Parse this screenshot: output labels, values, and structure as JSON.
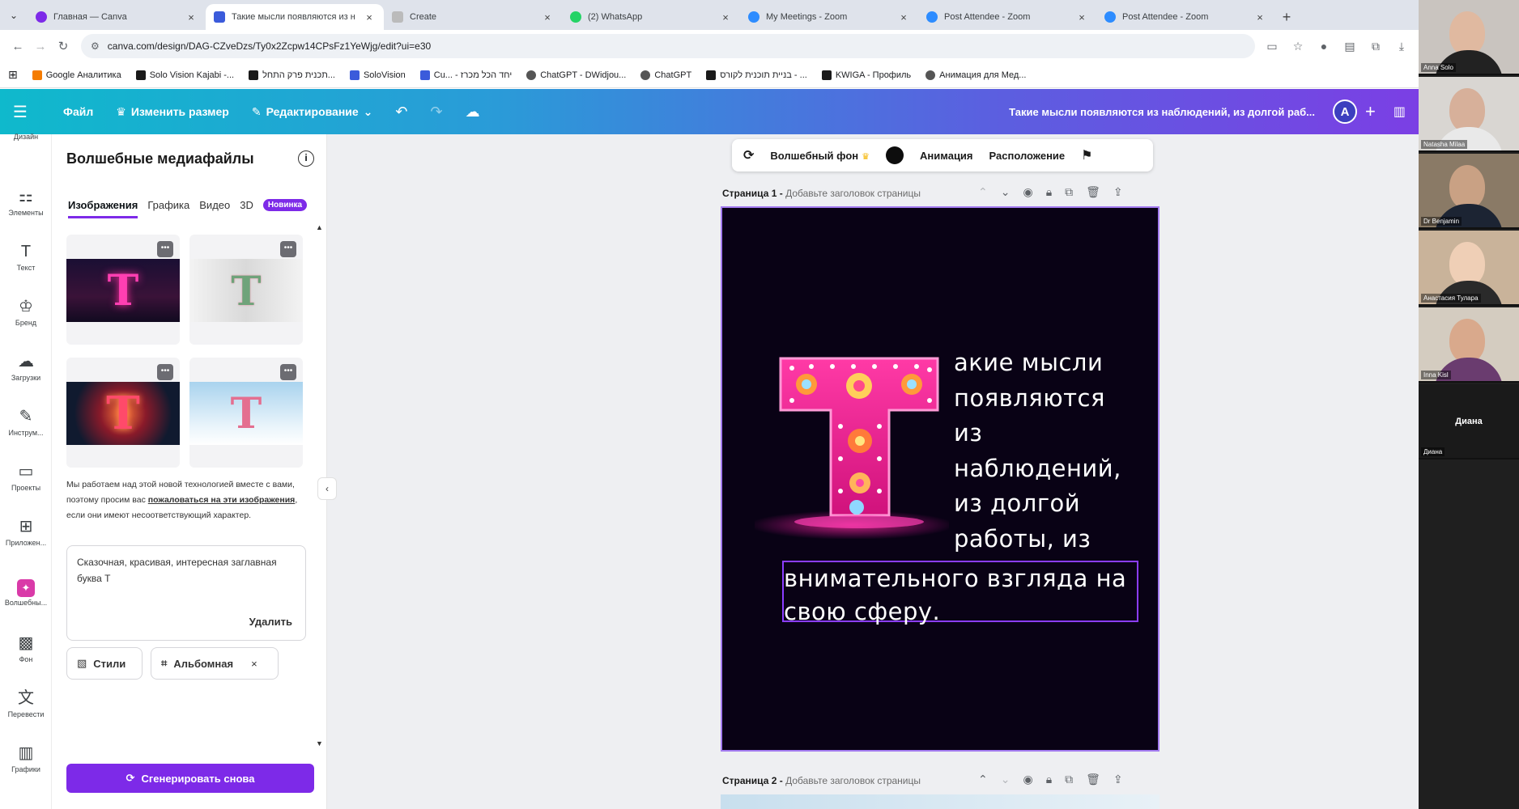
{
  "browser": {
    "tabs": [
      {
        "title": "Главная — Canva",
        "color": "#7d2ae8",
        "active": false
      },
      {
        "title": "Такие мысли появляются из н",
        "color": "#3b5bdb",
        "active": true
      },
      {
        "title": "Create",
        "color": "#999999",
        "active": false
      },
      {
        "title": "(2) WhatsApp",
        "color": "#25d366",
        "active": false
      },
      {
        "title": "My Meetings - Zoom",
        "color": "#2d8cff",
        "active": false
      },
      {
        "title": "Post Attendee - Zoom",
        "color": "#2d8cff",
        "active": false
      },
      {
        "title": "Post Attendee - Zoom",
        "color": "#2d8cff",
        "active": false
      }
    ],
    "url": "canva.com/design/DAG-CZveDzs/Ty0x2Zcpw14CPsFz1YeWjg/edit?ui=e30",
    "bookmarks": [
      {
        "label": "Google Аналитика",
        "color": "#f57c00"
      },
      {
        "label": "Solo Vision Kajabi -...",
        "color": "#1a1a1a"
      },
      {
        "label": "תכנית פרק התחל...",
        "color": "#1a1a1a"
      },
      {
        "label": "SoloVision",
        "color": "#3b5bdb"
      },
      {
        "label": "Cu... - יחד הכל מכרז",
        "color": "#3b5bdb"
      },
      {
        "label": "ChatGPT - DWidjou...",
        "color": "#555555"
      },
      {
        "label": "ChatGPT",
        "color": "#555555"
      },
      {
        "label": "בניית תוכנית לקורס - ...",
        "color": "#1a1a1a"
      },
      {
        "label": "KWIGA - Профиль",
        "color": "#1a1a1a"
      },
      {
        "label": "Анимация для Мед...",
        "color": "#555555"
      }
    ]
  },
  "header": {
    "menu_file": "Файл",
    "menu_resize": "Изменить размер",
    "menu_edit": "Редактирование",
    "doc_title": "Такие мысли появляются из наблюдений, из долгой раб...",
    "avatar_letter": "A"
  },
  "rail": [
    {
      "label": "Дизайн",
      "icon": "▦"
    },
    {
      "label": "Элементы",
      "icon": "⚏"
    },
    {
      "label": "Текст",
      "icon": "T"
    },
    {
      "label": "Бренд",
      "icon": "♔"
    },
    {
      "label": "Загрузки",
      "icon": "☁"
    },
    {
      "label": "Инструм...",
      "icon": "✎"
    },
    {
      "label": "Проекты",
      "icon": "▭"
    },
    {
      "label": "Приложен...",
      "icon": "⊞"
    },
    {
      "label": "Волшебны...",
      "icon": "✦"
    },
    {
      "label": "Фон",
      "icon": "▩"
    },
    {
      "label": "Перевести",
      "icon": "文"
    },
    {
      "label": "Графики",
      "icon": "▥"
    }
  ],
  "panel": {
    "title": "Волшебные медиафайлы",
    "tabs": [
      "Изображения",
      "Графика",
      "Видео",
      "3D"
    ],
    "new_badge": "Новинка",
    "disclaimer_before": "Мы работаем над этой новой технологией вместе с вами, поэтому просим вас ",
    "disclaimer_link": "пожаловаться на эти изображения",
    "disclaimer_after": ", если они имеют несоответствующий характер.",
    "prompt": "Сказочная, красивая, интересная заглавная буква Т",
    "delete": "Удалить",
    "chip_styles": "Стили",
    "chip_format": "Альбомная",
    "regenerate": "Сгенерировать снова"
  },
  "toolbar": {
    "magic_bg": "Волшебный фон",
    "animation": "Анимация",
    "position": "Расположение"
  },
  "pages": {
    "page1_label": "Страница 1 -",
    "page1_hint": "Добавьте заголовок страницы",
    "page2_label": "Страница 2 -",
    "page2_hint": "Добавьте заголовок страницы"
  },
  "design": {
    "big_letter": "T",
    "lines": [
      "акие мысли",
      "появляются",
      "из",
      "наблюдений,",
      "из долгой",
      "работы, из"
    ],
    "selected_text_1": "внимательного взгляда на",
    "selected_text_2": "свою сферу."
  },
  "zoom": [
    {
      "name": "Anna Solo",
      "bg": "#c9c4bf",
      "skin": "#e0b9a0",
      "shirt": "#222222"
    },
    {
      "name": "Natasha Milaa",
      "bg": "#d9d6d2",
      "skin": "#d7b09a",
      "shirt": "#e9e9e9"
    },
    {
      "name": "Dr Benjamin",
      "bg": "#8a7a66",
      "skin": "#c9a184",
      "shirt": "#1c2433"
    },
    {
      "name": "Анастасия Тулара",
      "bg": "#c9b39a",
      "skin": "#efcfb6",
      "shirt": "#2a2a2a"
    },
    {
      "name": "Inna Kisl",
      "bg": "#d4ccc0",
      "skin": "#d9a98c",
      "shirt": "#6a3c6f"
    },
    {
      "name": "Диана",
      "bg": "#1a1a1a",
      "skin": "#1a1a1a",
      "shirt": "#1a1a1a",
      "label_center": "Диана"
    }
  ]
}
